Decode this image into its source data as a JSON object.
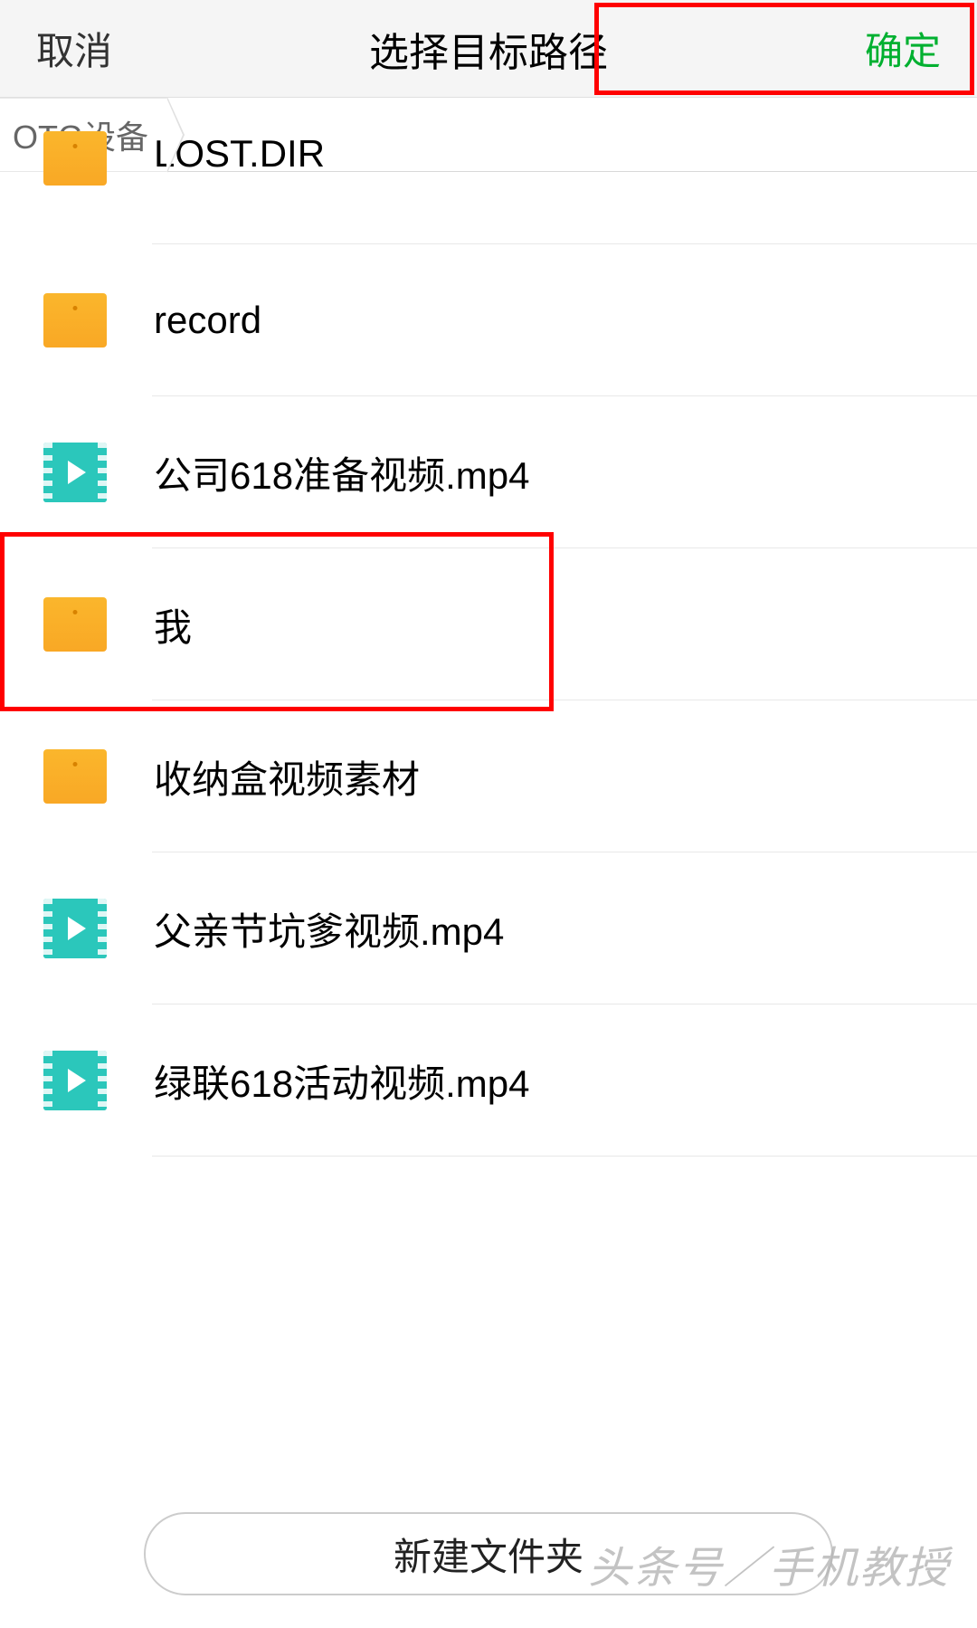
{
  "header": {
    "cancel": "取消",
    "title": "选择目标路径",
    "confirm": "确定"
  },
  "breadcrumb": {
    "item": "OTG设备"
  },
  "files": [
    {
      "name": "LOST.DIR",
      "type": "folder"
    },
    {
      "name": "record",
      "type": "folder"
    },
    {
      "name": "公司618准备视频.mp4",
      "type": "video"
    },
    {
      "name": "我",
      "type": "folder"
    },
    {
      "name": "收纳盒视频素材",
      "type": "folder"
    },
    {
      "name": "父亲节坑爹视频.mp4",
      "type": "video"
    },
    {
      "name": "绿联618活动视频.mp4",
      "type": "video"
    }
  ],
  "newFolder": "新建文件夹",
  "watermark": "头条号／手机教授"
}
